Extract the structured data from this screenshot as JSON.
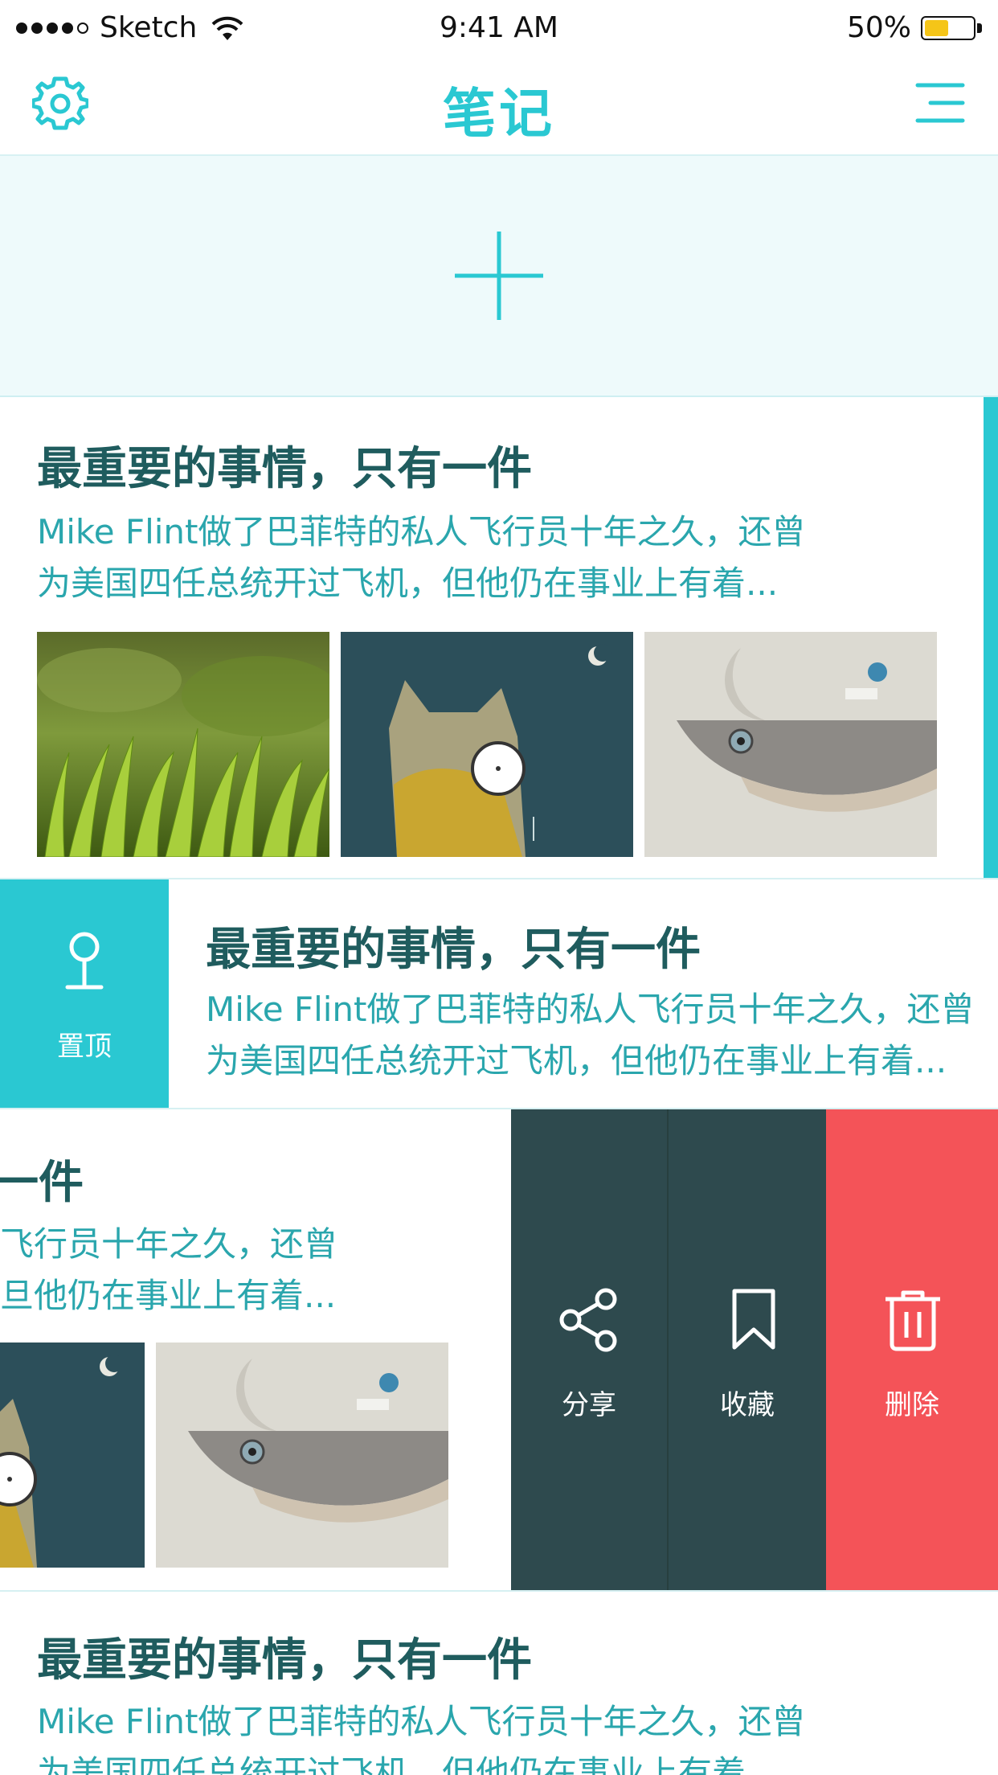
{
  "status": {
    "carrier": "Sketch",
    "time": "9:41 AM",
    "battery": "50%",
    "battery_level": 0.5
  },
  "nav": {
    "title": "笔记",
    "settings_icon": "gear-icon",
    "menu_icon": "menu-icon"
  },
  "add": {
    "icon": "plus-icon"
  },
  "notes": [
    {
      "title": "最重要的事情，只有一件",
      "line1": "Mike Flint做了巴菲特的私人飞行员十年之久，还曾",
      "line2": "为美国四任总统开过飞机，但他仍在事业上有着..."
    },
    {
      "title": "最重要的事情，只有一件",
      "line1": "Mike Flint做了巴菲特的私人飞行员十年之久，还曾",
      "line2": "为美国四任总统开过飞机，但他仍在事业上有着..."
    },
    {
      "title": "一件",
      "line1": "飞行员十年之久，还曾",
      "line2": "旦他仍在事业上有着..."
    },
    {
      "title": "最重要的事情，只有一件",
      "line1": "Mike Flint做了巴菲特的私人飞行员十年之久，还曾",
      "line2": "为美国四任总统开过飞机，但他仍在事业上有着..."
    }
  ],
  "actions": {
    "pin": "置顶",
    "share": "分享",
    "favorite": "收藏",
    "delete": "删除"
  },
  "colors": {
    "accent": "#2ac8d2",
    "dark": "#2e4a4e",
    "delete": "#f45358",
    "title": "#1f5c5e"
  }
}
